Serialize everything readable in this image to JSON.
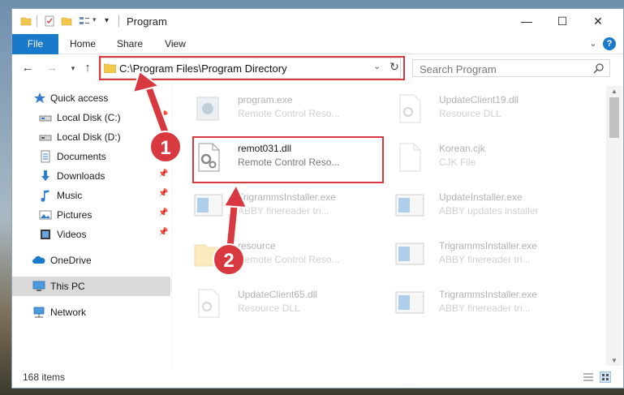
{
  "window": {
    "title": "Program"
  },
  "ribbon": {
    "tabs": [
      "File",
      "Home",
      "Share",
      "View"
    ]
  },
  "address": {
    "path": "C:\\Program Files\\Program Directory"
  },
  "search": {
    "placeholder": "Search Program"
  },
  "sidebar": {
    "items": [
      {
        "label": "Quick access",
        "icon": "star-icon"
      },
      {
        "label": "Local Disk (C:)",
        "icon": "drive-icon",
        "pinned": true
      },
      {
        "label": "Local Disk (D:)",
        "icon": "drive-icon"
      },
      {
        "label": "Documents",
        "icon": "documents-icon"
      },
      {
        "label": "Downloads",
        "icon": "download-icon",
        "pinned": true
      },
      {
        "label": "Music",
        "icon": "music-icon",
        "pinned": true
      },
      {
        "label": "Pictures",
        "icon": "pictures-icon",
        "pinned": true
      },
      {
        "label": "Videos",
        "icon": "videos-icon",
        "pinned": true
      },
      {
        "label": "OneDrive",
        "icon": "cloud-icon"
      },
      {
        "label": "This PC",
        "icon": "monitor-icon",
        "selected": true
      },
      {
        "label": "Network",
        "icon": "network-icon"
      }
    ]
  },
  "files": [
    {
      "name": "program.exe",
      "desc": "Remote Control Reso...",
      "icon": "exe-icon",
      "faded": true
    },
    {
      "name": "UpdateClient19.dll",
      "desc": "Resource DLL",
      "icon": "dll-icon",
      "faded": true
    },
    {
      "name": "remot031.dll",
      "desc": "Remote Control Reso...",
      "icon": "dll-gear-icon",
      "faded": false
    },
    {
      "name": "Korean.cjk",
      "desc": "CJK File",
      "icon": "file-icon",
      "faded": true
    },
    {
      "name": "TrigrammsInstaller.exe",
      "desc": "ABBY finereader tri...",
      "icon": "installer-icon",
      "faded": true
    },
    {
      "name": "UpdateInstaller.exe",
      "desc": "ABBY updates installer",
      "icon": "installer-icon",
      "faded": true
    },
    {
      "name": "resource",
      "desc": "Remote Control Reso...",
      "icon": "folder-icon",
      "faded": true
    },
    {
      "name": "TrigrammsInstaller.exe",
      "desc": "ABBY finereader tri...",
      "icon": "installer-icon",
      "faded": true
    },
    {
      "name": "UpdateClient65.dll",
      "desc": "Resource DLL",
      "icon": "dll-icon",
      "faded": true
    },
    {
      "name": "TrigrammsInstaller.exe",
      "desc": "ABBY finereader tri...",
      "icon": "installer-icon",
      "faded": true
    }
  ],
  "status": {
    "item_count": "168 items"
  },
  "annotations": {
    "step1": "1",
    "step2": "2",
    "highlight_color": "#d8383f"
  },
  "colors": {
    "accent": "#1979ca"
  }
}
